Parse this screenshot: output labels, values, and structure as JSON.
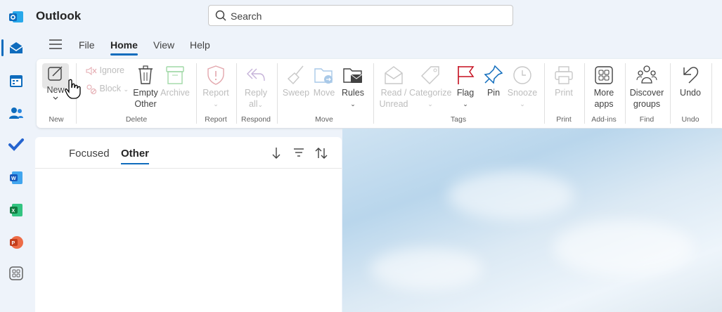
{
  "app": {
    "name": "Outlook"
  },
  "search": {
    "placeholder": "Search"
  },
  "menu": {
    "items": [
      "File",
      "Home",
      "View",
      "Help"
    ],
    "active": "Home"
  },
  "ribbon": {
    "new": {
      "label": "New",
      "group": "New"
    },
    "delete": {
      "ignore": "Ignore",
      "block": "Block",
      "empty_line1": "Empty",
      "empty_line2": "Other",
      "archive": "Archive",
      "group": "Delete"
    },
    "report": {
      "label": "Report",
      "group": "Report"
    },
    "respond": {
      "reply_line1": "Reply",
      "reply_line2": "all",
      "group": "Respond"
    },
    "move": {
      "sweep": "Sweep",
      "move": "Move",
      "rules": "Rules",
      "group": "Move"
    },
    "tags": {
      "read_line1": "Read /",
      "read_line2": "Unread",
      "categorize": "Categorize",
      "flag": "Flag",
      "pin": "Pin",
      "snooze": "Snooze",
      "group": "Tags"
    },
    "print": {
      "label": "Print",
      "group": "Print"
    },
    "addins": {
      "line1": "More",
      "line2": "apps",
      "group": "Add-ins"
    },
    "find": {
      "line1": "Discover",
      "line2": "groups",
      "group": "Find"
    },
    "undo": {
      "label": "Undo",
      "group": "Undo"
    }
  },
  "list": {
    "tabs": [
      "Focused",
      "Other"
    ],
    "active_tab": "Other"
  },
  "colors": {
    "accent": "#0f6cbd",
    "flag": "#c50f1f"
  }
}
